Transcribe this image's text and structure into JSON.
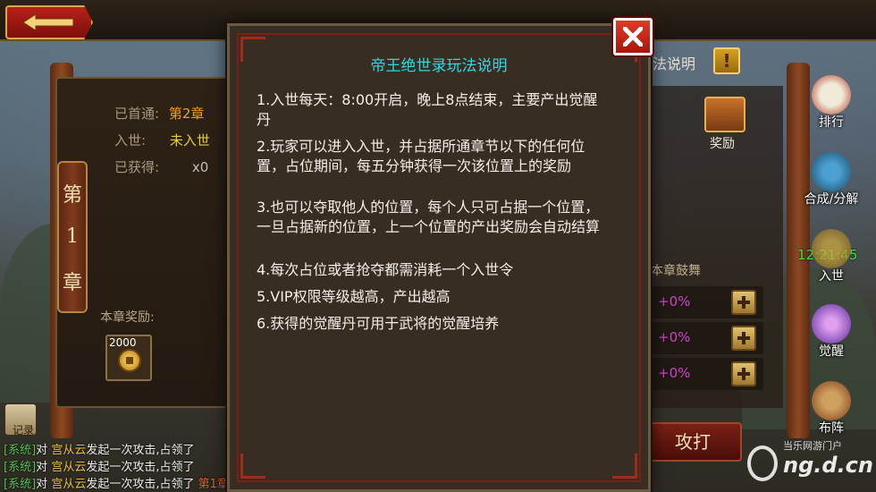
{
  "left_panel": {
    "first_clear_label": "已首通:",
    "first_clear_value": "第2章",
    "enter_label": "入世:",
    "enter_value": "未入世",
    "obtained_label": "已获得:",
    "obtained_value": "x0",
    "chapter": [
      "第",
      "1",
      "章"
    ],
    "reward_label": "本章奖励:",
    "reward_count": "2000",
    "reward_icon": "coin-icon"
  },
  "right_panel": {
    "rules_label": "法说明",
    "rules_icon": "!",
    "reward_label": "奖励",
    "boost_title": "本章鼓舞",
    "boosts": [
      "+0%",
      "+0%",
      "+0%"
    ],
    "attack_label": "攻打"
  },
  "side_buttons": {
    "rank": "排行",
    "synthesis": "合成/分解",
    "timer": "12:21:45",
    "enter": "入世",
    "awaken": "觉醒",
    "formation": "布阵"
  },
  "chat": {
    "log_label": "记录",
    "lines": [
      {
        "tag": "[系统]",
        "pre": "对",
        "name": "宫从云",
        "text": "发起一次攻击,占领了",
        "chapter": ""
      },
      {
        "tag": "[系统]",
        "pre": "对",
        "name": "宫从云",
        "text": "发起一次攻击,占领了",
        "chapter": ""
      },
      {
        "tag": "[系统]",
        "pre": "对",
        "name": "宫从云",
        "text": "发起一次攻击,占领了",
        "chapter": "第1章"
      }
    ]
  },
  "modal": {
    "title": "帝王绝世录玩法说明",
    "rules": [
      "1.入世每天：8:00开启，晚上8点结束，主要产出觉醒丹",
      "2.玩家可以进入入世，并占据所通章节以下的任何位置，占位期间，每五分钟获得一次该位置上的奖励",
      "3.也可以夺取他人的位置，每个人只可占据一个位置，一旦占据新的位置，上一个位置的产出奖励会自动结算",
      "4.每次占位或者抢夺都需消耗一个入世令",
      "5.VIP权限等级越高，产出越高",
      "6.获得的觉醒丹可用于武将的觉醒培养"
    ],
    "close_icon": "close-icon"
  },
  "watermark": {
    "small": "当乐网游门户",
    "big": "ng.d.cn"
  },
  "colors": {
    "title_cyan": "#30d8e0",
    "close_red": "#e23a26",
    "chat_green": "#50c050",
    "chat_name": "#e8c040",
    "boost_magenta": "#d040d0",
    "timer_green": "#40e040"
  }
}
